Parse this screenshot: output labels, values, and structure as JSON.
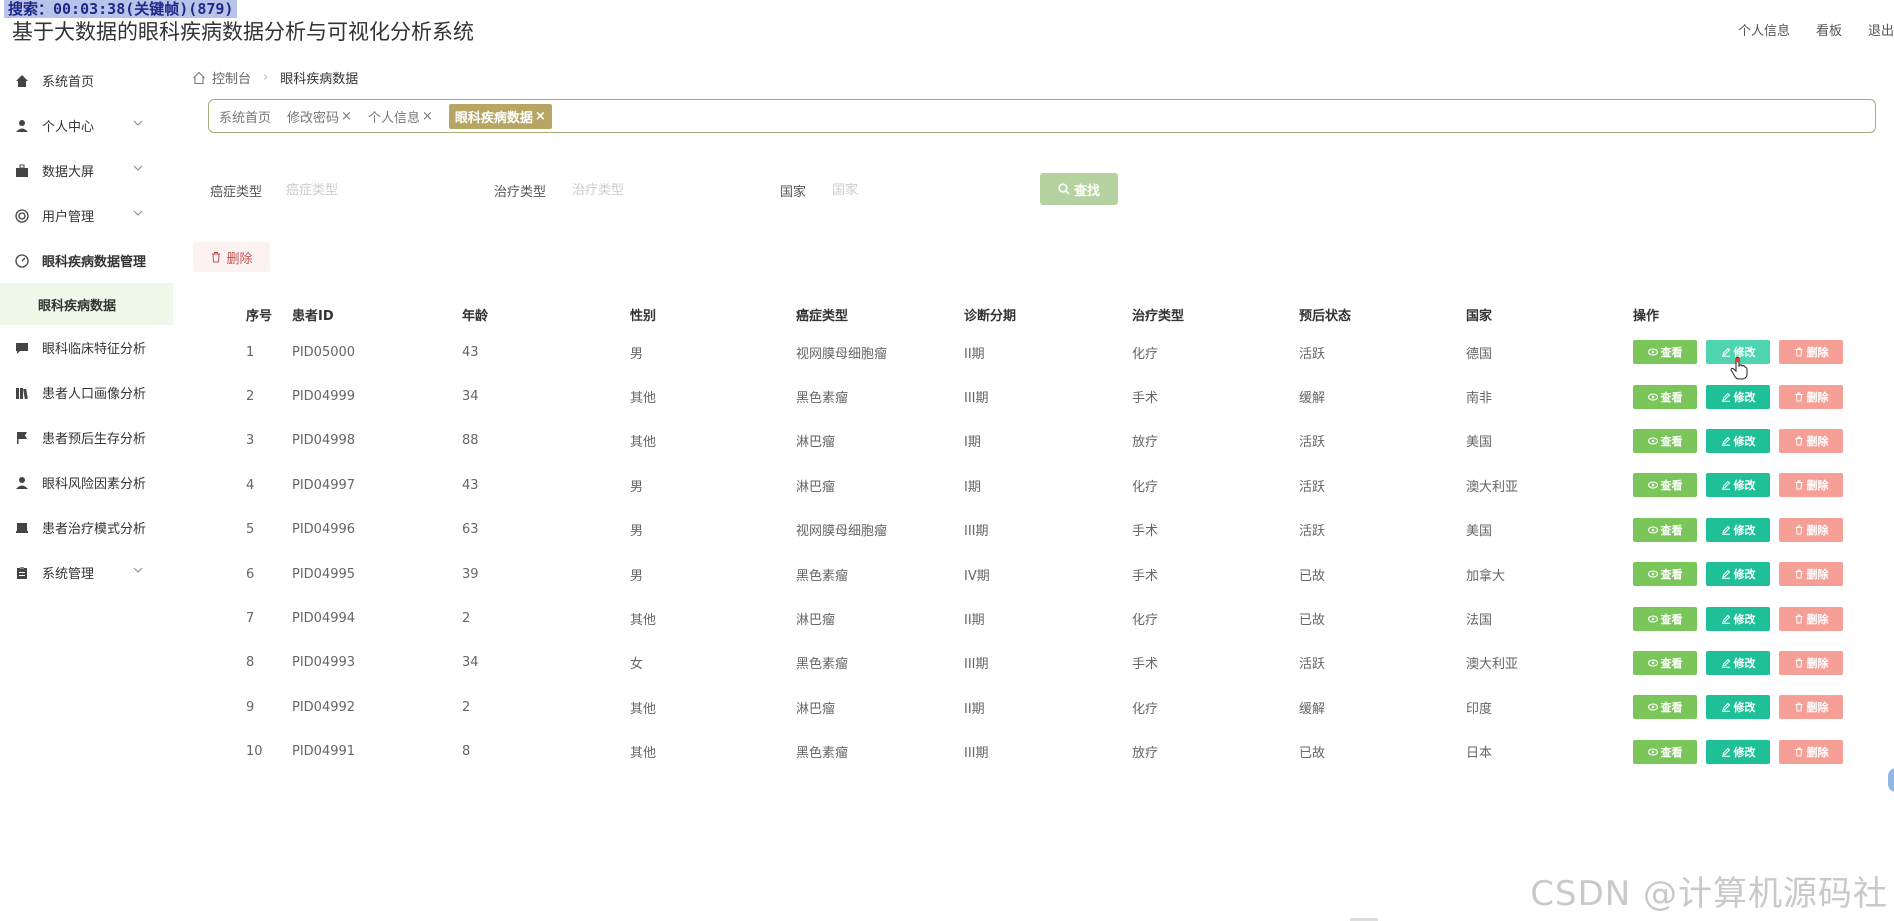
{
  "overlay": "搜索：00:03:38(关键帧)(879)",
  "app": {
    "title": "基于大数据的眼科疾病数据分析与可视化分析系统"
  },
  "top_links": [
    "个人信息",
    "看板",
    "退出"
  ],
  "sidebar": {
    "items": [
      {
        "label": "系统首页",
        "icon": "home-icon",
        "has_submenu": false
      },
      {
        "label": "个人中心",
        "icon": "user-icon",
        "has_submenu": true
      },
      {
        "label": "数据大屏",
        "icon": "briefcase-icon",
        "has_submenu": true
      },
      {
        "label": "用户管理",
        "icon": "lifebuoy-icon",
        "has_submenu": true
      },
      {
        "label": "眼科疾病数据管理",
        "icon": "gauge-icon",
        "has_submenu": false
      },
      {
        "label": "眼科临床特征分析",
        "icon": "chat-icon",
        "has_submenu": false
      },
      {
        "label": "患者人口画像分析",
        "icon": "book-icon",
        "has_submenu": false
      },
      {
        "label": "患者预后生存分析",
        "icon": "flag-icon",
        "has_submenu": false
      },
      {
        "label": "眼科风险因素分析",
        "icon": "person-icon",
        "has_submenu": false
      },
      {
        "label": "患者治疗模式分析",
        "icon": "monitor-icon",
        "has_submenu": false
      },
      {
        "label": "系统管理",
        "icon": "clipboard-icon",
        "has_submenu": true
      }
    ],
    "active_sub": "眼科疾病数据"
  },
  "breadcrumb": {
    "home": "控制台",
    "current": "眼科疾病数据"
  },
  "tags": [
    {
      "label": "系统首页",
      "closable": false,
      "active": false
    },
    {
      "label": "修改密码",
      "closable": true,
      "active": false
    },
    {
      "label": "个人信息",
      "closable": true,
      "active": false
    },
    {
      "label": "眼科疾病数据",
      "closable": true,
      "active": true
    }
  ],
  "search": {
    "fields": [
      {
        "label": "癌症类型",
        "placeholder": "癌症类型",
        "value": ""
      },
      {
        "label": "治疗类型",
        "placeholder": "治疗类型",
        "value": ""
      },
      {
        "label": "国家",
        "placeholder": "国家",
        "value": ""
      }
    ],
    "button_label": "查找"
  },
  "batch_delete_label": "删除",
  "table": {
    "headers": [
      "序号",
      "患者ID",
      "年龄",
      "性别",
      "癌症类型",
      "诊断分期",
      "治疗类型",
      "预后状态",
      "国家",
      "操作"
    ],
    "rows": [
      [
        "1",
        "PID05000",
        "43",
        "男",
        "视网膜母细胞瘤",
        "II期",
        "化疗",
        "活跃",
        "德国"
      ],
      [
        "2",
        "PID04999",
        "34",
        "其他",
        "黑色素瘤",
        "III期",
        "手术",
        "缓解",
        "南非"
      ],
      [
        "3",
        "PID04998",
        "88",
        "其他",
        "淋巴瘤",
        "I期",
        "放疗",
        "活跃",
        "美国"
      ],
      [
        "4",
        "PID04997",
        "43",
        "男",
        "淋巴瘤",
        "I期",
        "化疗",
        "活跃",
        "澳大利亚"
      ],
      [
        "5",
        "PID04996",
        "63",
        "男",
        "视网膜母细胞瘤",
        "III期",
        "手术",
        "活跃",
        "美国"
      ],
      [
        "6",
        "PID04995",
        "39",
        "男",
        "黑色素瘤",
        "IV期",
        "手术",
        "已故",
        "加拿大"
      ],
      [
        "7",
        "PID04994",
        "2",
        "其他",
        "淋巴瘤",
        "II期",
        "化疗",
        "已故",
        "法国"
      ],
      [
        "8",
        "PID04993",
        "34",
        "女",
        "黑色素瘤",
        "III期",
        "手术",
        "活跃",
        "澳大利亚"
      ],
      [
        "9",
        "PID04992",
        "2",
        "其他",
        "淋巴瘤",
        "II期",
        "化疗",
        "缓解",
        "印度"
      ],
      [
        "10",
        "PID04991",
        "8",
        "其他",
        "黑色素瘤",
        "III期",
        "放疗",
        "已故",
        "日本"
      ]
    ],
    "actions": {
      "view": "查看",
      "edit": "修改",
      "delete": "删除"
    }
  },
  "watermark": "CSDN @计算机源码社",
  "colors": {
    "accent": "#b7a663",
    "view": "#7ac65a",
    "edit": "#1fbf98",
    "delete": "#f59f96",
    "search": "#b5d3a0"
  }
}
